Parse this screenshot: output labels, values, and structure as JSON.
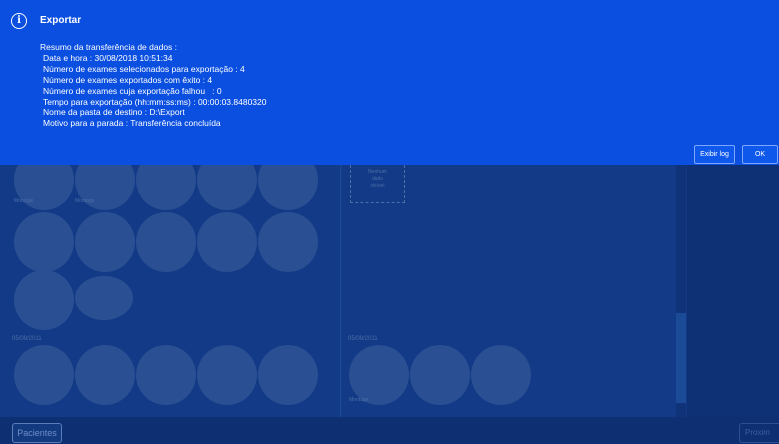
{
  "dialog": {
    "title": "Exportar",
    "icon": "info-icon",
    "lines": [
      "Resumo da transferência de dados :",
      "Data e hora : 30/08/2018 10:51:34",
      "Número de exames selecionados para exportação : 4",
      "Número de exames exportados com êxito : 4",
      "Número de exames cuja exportação falhou   : 0",
      "Tempo para exportação (hh:mm:ss:ms) : 00:00:03.8480320",
      "Nome da pasta de destino : D:\\Export",
      "Motivo para a parada : Transferência concluída"
    ],
    "show_log_label": "Exibir log",
    "ok_label": "OK"
  },
  "background": {
    "date_left": "05/09/2011",
    "date_right": "05/09/2011",
    "placeholder_box": [
      "Nenhum",
      "dado",
      "visível"
    ],
    "thumb_label": "Montage",
    "patients_button": "Pacientes",
    "right_button": "Proxim"
  }
}
